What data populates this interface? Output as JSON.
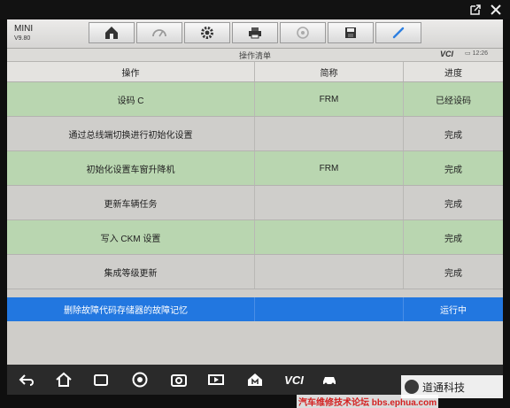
{
  "header": {
    "brand": "MINI",
    "version": "V9.80"
  },
  "subheader": {
    "title": "操作清单",
    "vci_label": "VCI",
    "time": "12:26"
  },
  "table": {
    "columns": [
      "操作",
      "简称",
      "进度"
    ],
    "rows": [
      {
        "operation": "设码 C",
        "abbr": "FRM",
        "progress": "已经设码",
        "status": "done"
      },
      {
        "operation": "通过总线端切换进行初始化设置",
        "abbr": "",
        "progress": "完成",
        "status": "neutral"
      },
      {
        "operation": "初始化设置车窗升降机",
        "abbr": "FRM",
        "progress": "完成",
        "status": "done"
      },
      {
        "operation": "更新车辆任务",
        "abbr": "",
        "progress": "完成",
        "status": "neutral"
      },
      {
        "operation": "写入 CKM 设置",
        "abbr": "",
        "progress": "完成",
        "status": "done"
      },
      {
        "operation": "集成等级更新",
        "abbr": "",
        "progress": "完成",
        "status": "neutral"
      },
      {
        "operation": "删除故障代码存储器的故障记忆",
        "abbr": "",
        "progress": "运行中",
        "status": "running"
      }
    ]
  },
  "navbar": {
    "vci_label": "VCI"
  },
  "watermark": {
    "channel": "道通科技",
    "forum": "汽车维修技术论坛 bbs.ephua.com"
  },
  "colors": {
    "done_row": "#b9d6b0",
    "neutral_row": "#cfcecb",
    "running_row": "#2277e0"
  },
  "icons": [
    "home-icon",
    "mileage-icon",
    "settings-icon",
    "print-icon",
    "help-icon",
    "save-icon",
    "pen-icon",
    "external-link-icon",
    "close-icon",
    "back-icon",
    "apps-icon",
    "browser-icon",
    "camera-icon",
    "vehicle-icon"
  ]
}
